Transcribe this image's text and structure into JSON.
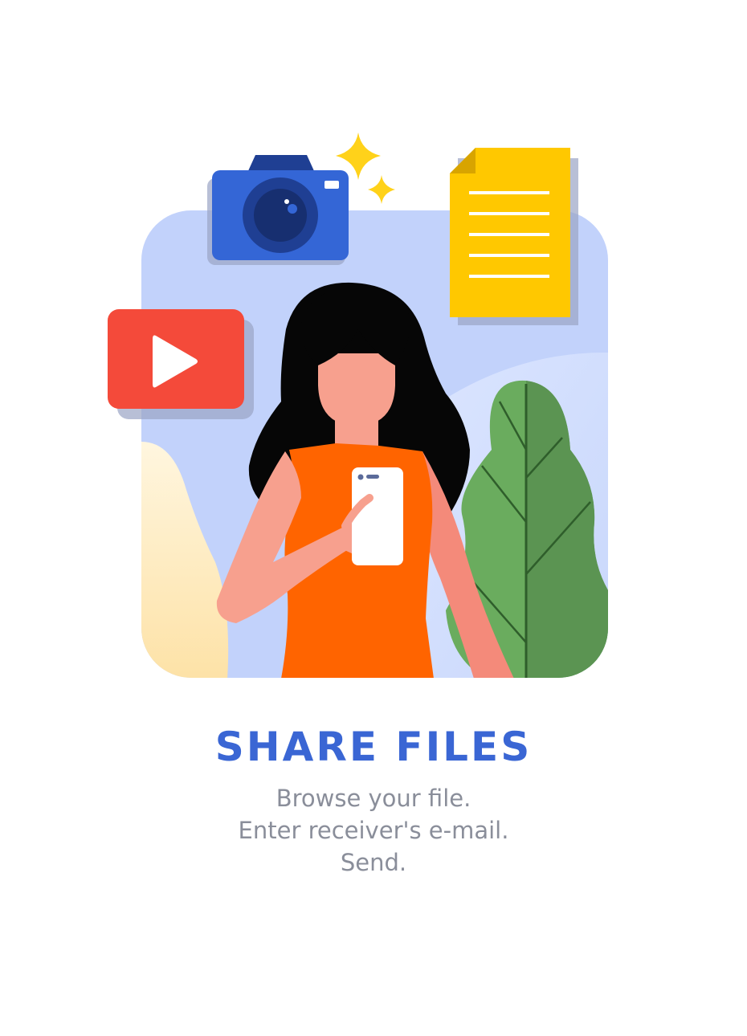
{
  "onboarding": {
    "title": "SHARE FILES",
    "lines": [
      "Browse your file.",
      "Enter receiver's e-mail.",
      "Send."
    ]
  },
  "illustration": {
    "icons": [
      "camera-icon",
      "document-icon",
      "play-icon",
      "sparkle-icon",
      "smartphone-icon",
      "plant-icon"
    ]
  },
  "colors": {
    "title": "#3a66d4",
    "text": "#8a8e9a",
    "panel": "#c2d2fb",
    "camera": "#3466d6",
    "document": "#ffc800",
    "play": "#f44a3a",
    "dress": "#ff6400",
    "skin": "#f7a08e",
    "leaf": "#6aac5e"
  }
}
